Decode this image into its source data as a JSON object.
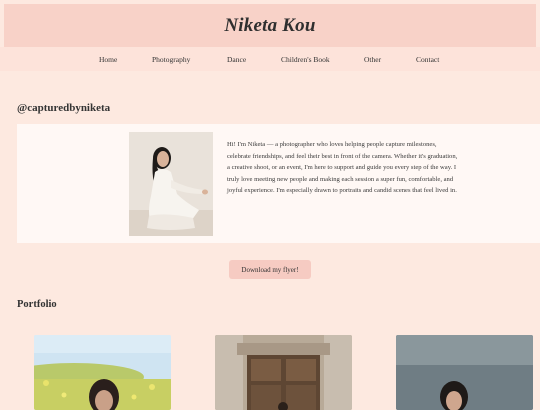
{
  "site": {
    "title": "Niketa Kou"
  },
  "nav": {
    "items": [
      {
        "label": "Home"
      },
      {
        "label": "Photography"
      },
      {
        "label": "Dance"
      },
      {
        "label": "Children's Book"
      },
      {
        "label": "Other"
      },
      {
        "label": "Contact"
      }
    ]
  },
  "about": {
    "handle": "@capturedbyniketa",
    "bio": "Hi! I'm Niketa — a photographer who loves helping people capture milestones, celebrate friendships, and feel their best in front of the camera. Whether it's graduation, a creative shoot, or an event, I'm here to support and guide you every step of the way. I truly love meeting new people and making each session a super fun, comfortable, and joyful experience. I'm especially drawn to portraits and candid scenes that feel lived in."
  },
  "actions": {
    "flyer_label": "Download my flyer!"
  },
  "portfolio": {
    "title": "Portfolio"
  },
  "colors": {
    "background": "#fde9e0",
    "header": "#f8d2c8",
    "card": "#fff8f5",
    "button": "#f6cbc2"
  }
}
